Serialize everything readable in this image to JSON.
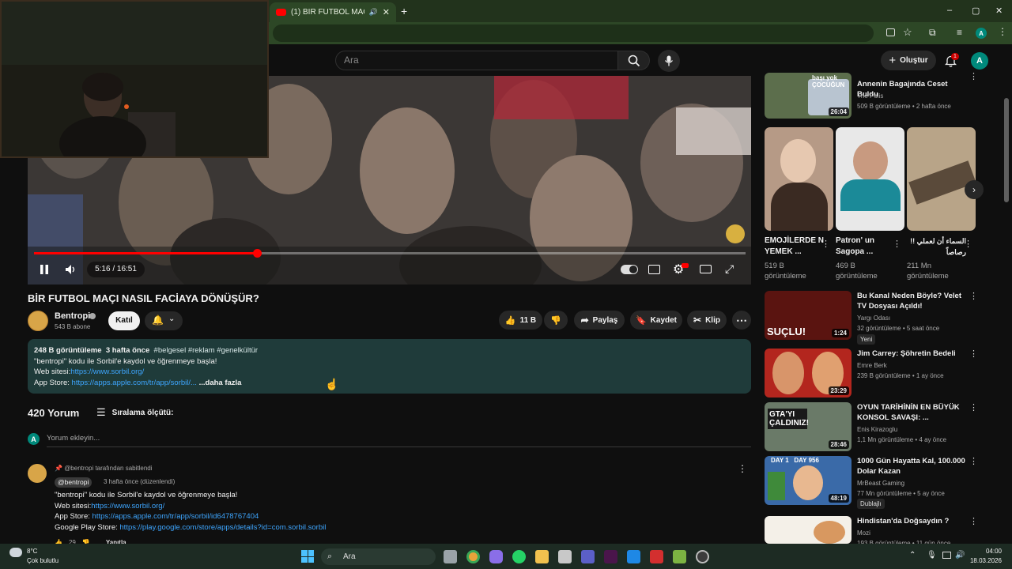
{
  "browser": {
    "tab_title": "(1) BİR FUTBOL MAÇI NASIL",
    "new_tab": "+",
    "window_controls": [
      "–",
      "▢",
      "✕"
    ],
    "profile_initial": "A"
  },
  "header": {
    "search_placeholder": "Ara",
    "create_label": "Oluştur",
    "notification_count": "1",
    "avatar_initial": "A"
  },
  "player": {
    "time": "5:16 / 16:51",
    "progress": 0.313
  },
  "video": {
    "title": "BİR FUTBOL MAÇI NASIL FACİAYA DÖNÜŞÜR?",
    "channel": "Bentropi",
    "subscribers": "543 B abone",
    "join_label": "Katıl",
    "likes": "11 B",
    "share_label": "Paylaş",
    "save_label": "Kaydet",
    "clip_label": "Klip"
  },
  "description": {
    "views": "248 B görüntüleme",
    "date": "3 hafta önce",
    "tags": "#belgesel #reklam #genelkültür",
    "line1": "\"bentropi\" kodu ile Sorbil'e kaydol ve öğrenmeye başla!",
    "site_label": "Web sitesi:",
    "site_link": "https://www.sorbil.org/",
    "appstore_label": "App Store: ",
    "appstore_link": "https://apps.apple.com/tr/app/sorbil/...",
    "more": "...daha fazla"
  },
  "comments": {
    "count_label": "420 Yorum",
    "sort_label": "Sıralama ölçütü:",
    "my_initial": "A",
    "add_placeholder": "Yorum ekleyin...",
    "pinned_label": "@bentropi tarafından sabitlendi",
    "author": "@bentropi",
    "time": "3 hafta önce (düzenlendi)",
    "line1": "\"bentropi\" kodu ile Sorbil'e kaydol ve öğrenmeye başla!",
    "site_label": "Web sitesi:",
    "site_link": "https://www.sorbil.org/",
    "appstore_label": "App Store: ",
    "appstore_link": "https://apps.apple.com/tr/app/sorbil/id6478767404",
    "play_label": "Google Play Store: ",
    "play_link": "https://play.google.com/store/apps/details?id=com.sorbil.sorbil",
    "likes": "29",
    "reply_label": "Yanıtla"
  },
  "recommendations": {
    "top": {
      "title": "Annenin Bagajında Ceset Buldu",
      "channel": "The Polis",
      "meta": "509 B görüntüleme • 2 hafta önce",
      "duration": "26:04",
      "thumb_text": "başı yok ÇOCUĞUN"
    },
    "shorts": [
      {
        "title": "EMOJİLERDE N YEMEK ...",
        "views": "519 B",
        "views_label": "görüntüleme"
      },
      {
        "title": "Patron' un Sagopa ...",
        "views": "469 B",
        "views_label": "görüntüleme"
      },
      {
        "title": "السماء أن لعملي !! رصاصاً",
        "views": "211 Mn",
        "views_label": "görüntüleme"
      }
    ],
    "list": [
      {
        "title": "Bu Kanal Neden Böyle? Velet TV Dosyası Açıldı!",
        "channel": "Yargı Odası",
        "meta": "32 görüntüleme • 5 saat önce",
        "badge": "Yeni",
        "duration": "1:24",
        "thumb_text": "SUÇLU!"
      },
      {
        "title": "Jim Carrey: Şöhretin Bedeli",
        "channel": "Emre Berk",
        "meta": "239 B görüntüleme • 1 ay önce",
        "badge": "",
        "duration": "23:29",
        "thumb_text": ""
      },
      {
        "title": "OYUN TARİHİNİN EN BÜYÜK KONSOL SAVAŞI: ...",
        "channel": "Enis Kirazoglu",
        "meta": "1,1 Mn görüntüleme • 4 ay önce",
        "badge": "",
        "duration": "28:46",
        "thumb_text": "GTA'YI ÇALDINIZ!"
      },
      {
        "title": "1000 Gün Hayatta Kal, 100.000 Dolar Kazan",
        "channel": "MrBeast Gaming",
        "meta": "77 Mn görüntüleme • 5 ay önce",
        "badge": "Dublajlı",
        "duration": "48:19",
        "thumb_text": "DAY 1   DAY 956"
      },
      {
        "title": "Hindistan'da Doğsaydın ?",
        "channel": "Mozi",
        "meta": "193 B görüntüleme • 11 gün önce",
        "badge": "",
        "duration": "",
        "thumb_text": ""
      }
    ]
  },
  "taskbar": {
    "temp": "8°C",
    "weather": "Çok bulutlu",
    "search": "Ara",
    "time": "04:00",
    "date": "18.03.2026"
  }
}
